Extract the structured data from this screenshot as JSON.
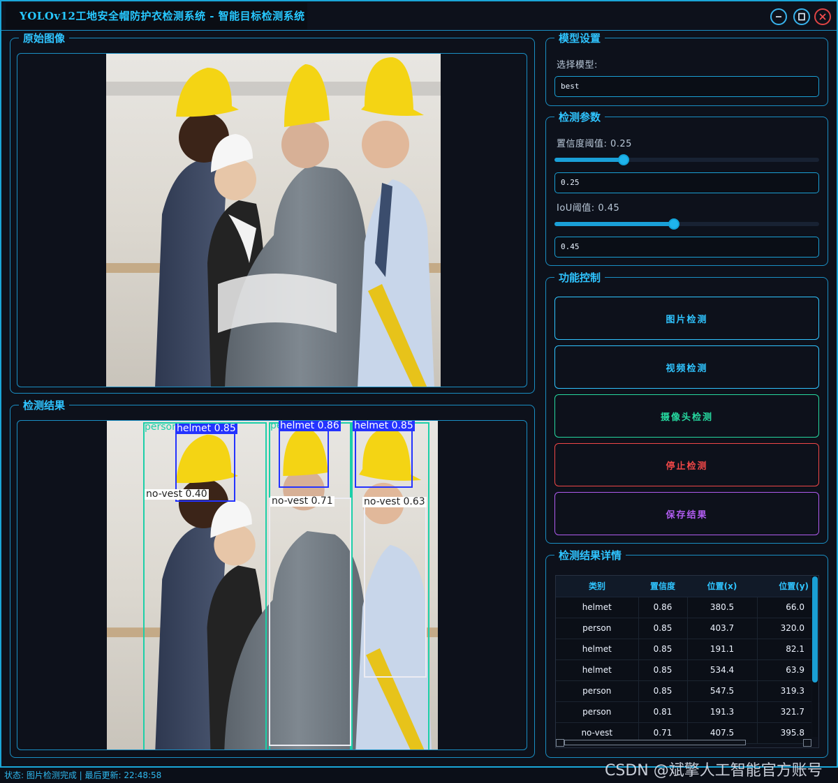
{
  "window": {
    "title": "YOLOv12工地安全帽防护衣检测系统 - 智能目标检测系统",
    "controls": [
      "minimize",
      "maximize",
      "close"
    ]
  },
  "left": {
    "original_title": "原始图像",
    "result_title": "检测结果",
    "detections": [
      {
        "label": "person",
        "color": "#1ccfa8"
      },
      {
        "label": "helmet 0.85",
        "color": "#2433ff"
      },
      {
        "label": "no-vest 0.40",
        "color": "#e8e8ee"
      },
      {
        "label": "pe",
        "color": "#1ccfa8"
      },
      {
        "label": "helmet 0.86",
        "color": "#2433ff"
      },
      {
        "label": "no-vest 0.71",
        "color": "#e8e8ee"
      },
      {
        "label": "helmet 0.85",
        "color": "#2433ff"
      },
      {
        "label": "no-vest 0.63",
        "color": "#e8e8ee"
      }
    ]
  },
  "model": {
    "group_title": "模型设置",
    "select_label": "选择模型:",
    "selected": "best"
  },
  "params": {
    "group_title": "检测参数",
    "conf_label": "置信度阈值: 0.25",
    "conf_value": "0.25",
    "conf_fraction": 0.26,
    "iou_label": "IoU阈值: 0.45",
    "iou_value": "0.45",
    "iou_fraction": 0.45
  },
  "controls": {
    "group_title": "功能控制",
    "image_btn": "图片检测",
    "video_btn": "视频检测",
    "camera_btn": "摄像头检测",
    "stop_btn": "停止检测",
    "save_btn": "保存结果",
    "colors": {
      "image": "#2fc4ff",
      "video": "#2fc4ff",
      "camera": "#26d9a0",
      "stop": "#ef4747",
      "save": "#b05cf0"
    }
  },
  "details": {
    "group_title": "检测结果详情",
    "columns": [
      "类别",
      "置信度",
      "位置(x)",
      "位置(y)"
    ],
    "rows": [
      [
        "helmet",
        "0.86",
        "380.5",
        "66.0"
      ],
      [
        "person",
        "0.85",
        "403.7",
        "320.0"
      ],
      [
        "helmet",
        "0.85",
        "191.1",
        "82.1"
      ],
      [
        "helmet",
        "0.85",
        "534.4",
        "63.9"
      ],
      [
        "person",
        "0.85",
        "547.5",
        "319.3"
      ],
      [
        "person",
        "0.81",
        "191.3",
        "321.7"
      ],
      [
        "no-vest",
        "0.71",
        "407.5",
        "395.8"
      ]
    ]
  },
  "status": {
    "text": "状态: 图片检测完成 | 最后更新: 22:48:58"
  },
  "watermark": "CSDN @斌擎人工智能官方账号"
}
